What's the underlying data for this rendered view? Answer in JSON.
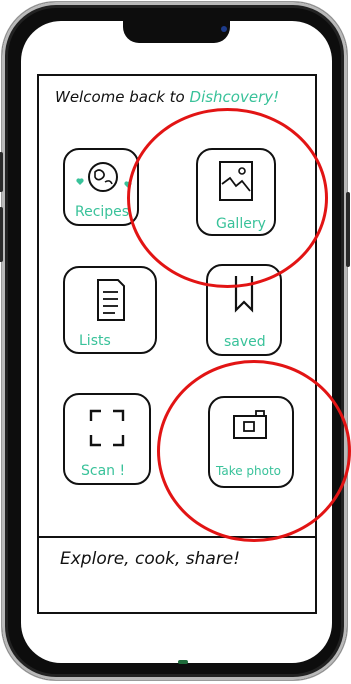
{
  "header": {
    "welcome": "Welcome back to",
    "brand": "Dishcovery!"
  },
  "tiles": [
    {
      "label": "Recipes",
      "icon": "globe-hearts-icon"
    },
    {
      "label": "Gallery",
      "icon": "image-icon"
    },
    {
      "label": "Lists",
      "icon": "document-icon"
    },
    {
      "label": "saved",
      "icon": "bookmark-icon"
    },
    {
      "label": "Scan !",
      "icon": "scan-frame-icon"
    },
    {
      "label": "Take photo",
      "icon": "camera-icon"
    }
  ],
  "footer": {
    "tagline": "Explore, cook, share!"
  },
  "colors": {
    "accent": "#39c29a",
    "highlight": "#e21414",
    "ink": "#111111"
  }
}
